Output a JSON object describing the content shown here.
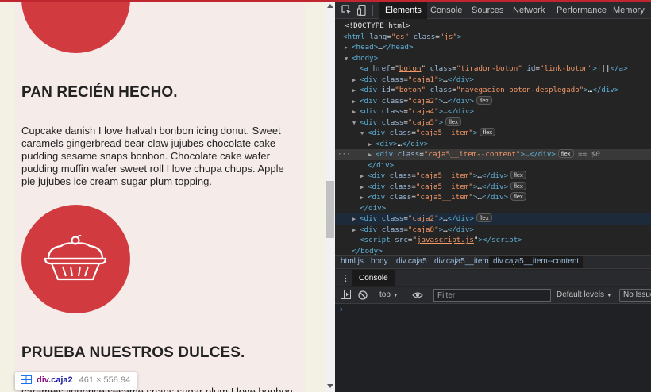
{
  "page": {
    "heading1": "PAN RECIÉN HECHO.",
    "paragraph1": "Cupcake danish I love halvah bonbon icing donut. Sweet caramels gingerbread bear claw jujubes chocolate cake pudding sesame snaps bonbon. Chocolate cake wafer pudding muffin wafer sweet roll I love chupa chups. Apple pie jujubes ice cream sugar plum topping.",
    "heading2": "PRUEBA NUESTROS DULCES.",
    "paragraph2": "caramels liquorice sesame snaps sugar plum I love bonbon. I",
    "accent_color": "#d13b3f"
  },
  "tooltip": {
    "tag": "div",
    "cls": ".caja2",
    "size": "461 × 558.94"
  },
  "devtools": {
    "tabs": [
      "Elements",
      "Console",
      "Sources",
      "Network",
      "Performance",
      "Memory"
    ],
    "active_tab": "Elements",
    "dom": {
      "doctype": "<!DOCTYPE html>",
      "html_lang": "\"es\"",
      "html_class": "\"js\"",
      "a_href": "boton",
      "a_class": "\"tirador-boton\"",
      "a_id": "\"link-boton\"",
      "a_text": "|||",
      "caja1": "\"caja1\"",
      "boton_id": "\"boton\"",
      "boton_class": "\"navegacion boton-desplegado\"",
      "caja2": "\"caja2\"",
      "caja4": "\"caja4\"",
      "caja5": "\"caja5\"",
      "item": "\"caja5__item\"",
      "item_content": "\"caja5__item--content\"",
      "caja8": "\"caja8\"",
      "script_src": "javascript.js",
      "flex_badge": "flex",
      "ref": "== $0",
      "ellipsis": "…"
    },
    "breadcrumbs": [
      "html.js",
      "body",
      "div.caja5",
      "div.caja5__item",
      "div.caja5__item--content"
    ],
    "drawer_tab": "Console",
    "console": {
      "context": "top",
      "filter_placeholder": "Filter",
      "levels": "Default levels",
      "issues": "No Issues",
      "prompt": "›"
    }
  }
}
